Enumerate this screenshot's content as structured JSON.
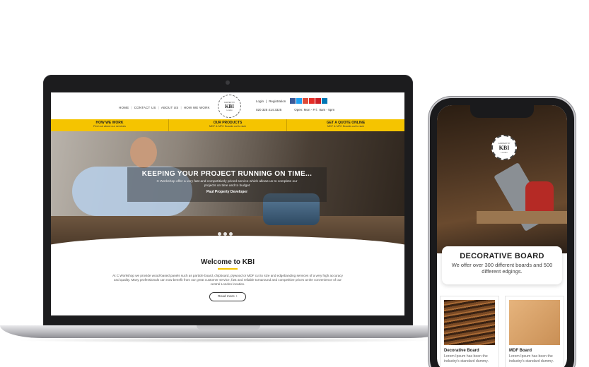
{
  "laptop_site": {
    "nav": [
      "HOME",
      "CONTACT US",
      "ABOUT US",
      "HOW WE WORK"
    ],
    "logo": {
      "name": "KBI",
      "arc_text": "CARPENTRY",
      "sub": "London"
    },
    "login": "Login",
    "registration": "Registration",
    "phone": "020 325 414 3325",
    "hours": "Open: Mon - Fri : 8am - 5pm",
    "social_icons": [
      "facebook-icon",
      "twitter-icon",
      "google-plus-icon",
      "youtube-icon",
      "pinterest-icon",
      "linkedin-icon"
    ],
    "social_colors": [
      "#3b5998",
      "#1da1f2",
      "#dd4b39",
      "#e52d27",
      "#cb2027",
      "#0077b5"
    ],
    "yellow_bar": [
      {
        "title": "HOW WE WORK",
        "sub": "Find out about our services"
      },
      {
        "title": "OUR PRODUCTS",
        "sub": "MDF & MFC Boards cut to size"
      },
      {
        "title": "GET A QUOTE ONLINE",
        "sub": "MDF & MFC Boards cut to size"
      }
    ],
    "hero": {
      "heading": "KEEPING YOUR PROJECT RUNNING ON TIME...",
      "text": "C Workshop offer a very fast and competitively priced service which allows us to complete our projects on time and to budget",
      "author": "Paul Property Developer"
    },
    "welcome": {
      "heading": "Welcome to KBI",
      "text": "At C Workshop we provide wood-based panels such as particle board, chipboard, plywood or MDF cut to size and edgebanding services of a very high accuracy and quality. Many professionals can now benefit from our great customer service, fast and reliable turnaround and competitive prices at the convenience of our central London location.",
      "button": "Read more +"
    },
    "accent_color": "#f5c400"
  },
  "phone_site": {
    "logo": {
      "name": "KBI",
      "arc_text": "CARPENTRY",
      "sub": "London"
    },
    "card": {
      "heading": "DECORATIVE BOARD",
      "text": "We offer over 300 different boards and 500 different edgings."
    },
    "products": [
      {
        "name": "Decorative Board",
        "desc": "Lorem Ipsum has been the industry's standard dummy."
      },
      {
        "name": "MDF Board",
        "desc": "Lorem Ipsum has been the industry's standard dummy."
      }
    ]
  }
}
